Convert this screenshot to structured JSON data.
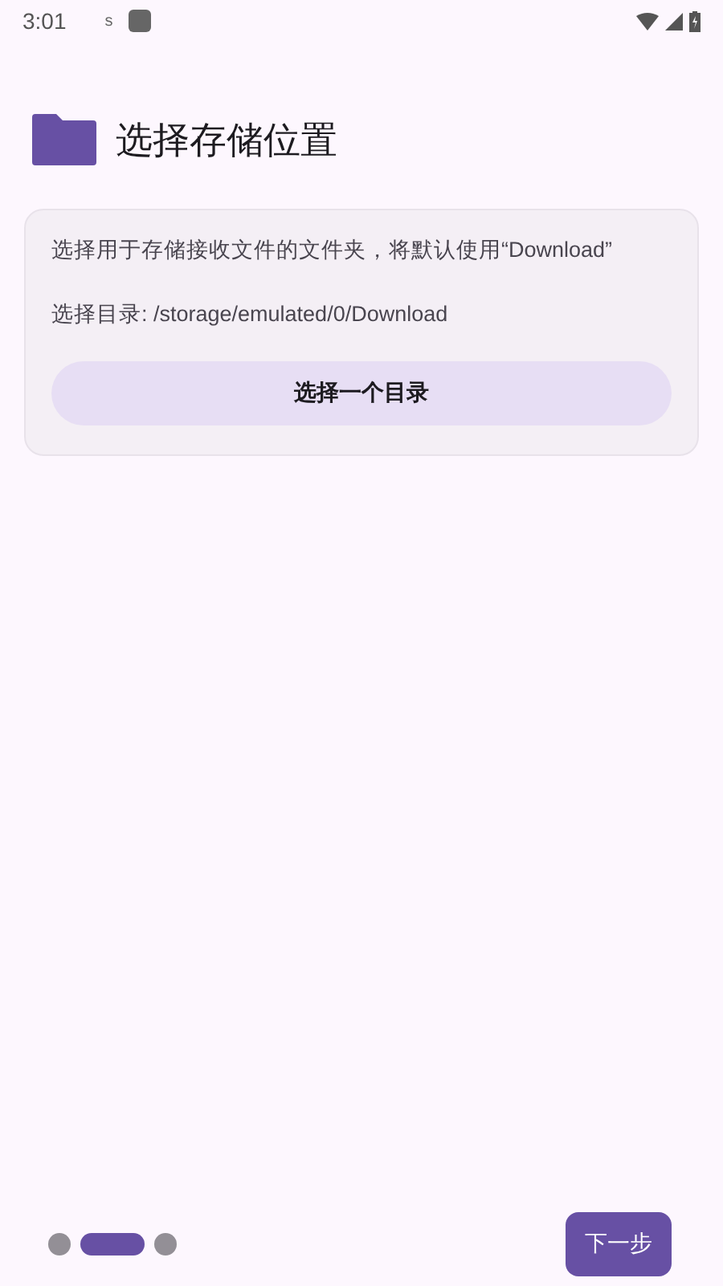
{
  "status_bar": {
    "time": "3:01",
    "notification": "s"
  },
  "header": {
    "title": "选择存储位置"
  },
  "card": {
    "description": "选择用于存储接收文件的文件夹，将默认使用“Download”",
    "directory": "选择目录: /storage/emulated/0/Download",
    "button": "选择一个目录"
  },
  "pager": {
    "dots": [
      {
        "selected": false
      },
      {
        "selected": true
      },
      {
        "selected": false
      }
    ]
  },
  "next_button": "下一步"
}
